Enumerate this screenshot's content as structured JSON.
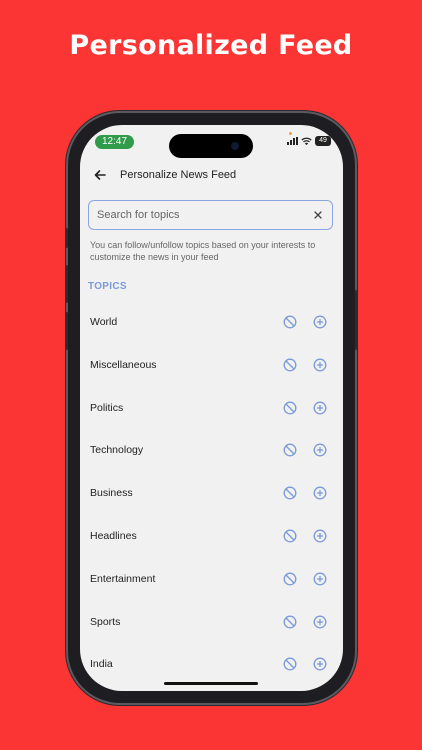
{
  "banner": {
    "title": "Personalized Feed"
  },
  "status_bar": {
    "time": "12:47",
    "battery": "49"
  },
  "nav": {
    "title": "Personalize News Feed",
    "back_icon": "arrow-left-icon"
  },
  "search": {
    "placeholder": "Search for topics",
    "value": "",
    "clear_icon": "close-icon"
  },
  "hint": "You can follow/unfollow topics based on your interests to customize the news in your feed",
  "section_title": "TOPICS",
  "topics": [
    {
      "label": "World"
    },
    {
      "label": "Miscellaneous"
    },
    {
      "label": "Politics"
    },
    {
      "label": "Technology"
    },
    {
      "label": "Business"
    },
    {
      "label": "Headlines"
    },
    {
      "label": "Entertainment"
    },
    {
      "label": "Sports"
    },
    {
      "label": "India"
    }
  ],
  "icons": {
    "block": "block-icon",
    "add": "plus-circle-icon"
  },
  "colors": {
    "background": "#fb3434",
    "accent": "#7a9ad8",
    "screen": "#f1f1f1"
  }
}
